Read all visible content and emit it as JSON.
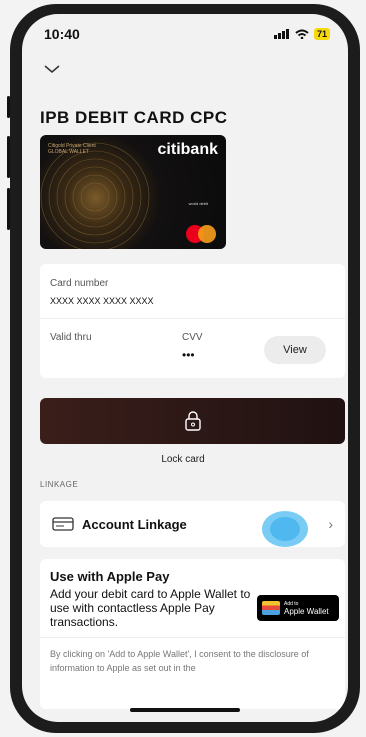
{
  "status": {
    "time": "10:40",
    "battery": "71"
  },
  "page": {
    "title": "IPB DEBIT CARD CPC"
  },
  "card": {
    "brand_small_1": "Citigold Private Client",
    "brand_small_2": "GLOBAL WALLET",
    "logo": "citibank",
    "tier": "world debit",
    "network_icon": "mastercard-icon"
  },
  "info": {
    "card_number_label": "Card number",
    "card_number_value": "XXXX XXXX XXXX XXXX",
    "valid_thru_label": "Valid thru",
    "cvv_label": "CVV",
    "cvv_value": "•••",
    "view_label": "View"
  },
  "lock": {
    "label": "Lock card"
  },
  "linkage": {
    "section_label": "LINKAGE",
    "item_label": "Account Linkage"
  },
  "apple_pay": {
    "title": "Use with Apple Pay",
    "description": "Add your debit card to Apple Wallet to use with contactless Apple Pay transactions.",
    "wallet_small": "Add to",
    "wallet_big": "Apple Wallet",
    "consent": "By clicking on 'Add to Apple Wallet', I consent to the disclosure of information to Apple as set out in the"
  },
  "colors": {
    "lock_bar": "#3a1e1a",
    "touch_indicator": "#6bc7f4"
  }
}
